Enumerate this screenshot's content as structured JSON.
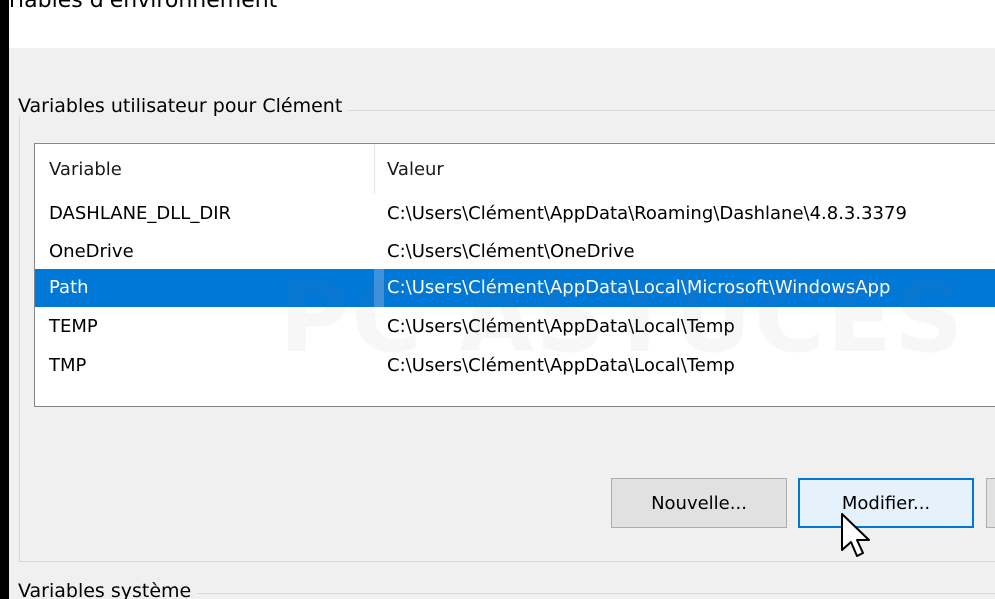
{
  "window": {
    "title": "riables d'environnement"
  },
  "user_group": {
    "label": "Variables utilisateur pour Clément",
    "columns": {
      "variable": "Variable",
      "valeur": "Valeur"
    },
    "rows": [
      {
        "name": "DASHLANE_DLL_DIR",
        "value": "C:\\Users\\Clément\\AppData\\Roaming\\Dashlane\\4.8.3.3379"
      },
      {
        "name": "OneDrive",
        "value": "C:\\Users\\Clément\\OneDrive"
      },
      {
        "name": "Path",
        "value": "C:\\Users\\Clément\\AppData\\Local\\Microsoft\\WindowsApp"
      },
      {
        "name": "TEMP",
        "value": "C:\\Users\\Clément\\AppData\\Local\\Temp"
      },
      {
        "name": "TMP",
        "value": "C:\\Users\\Clément\\AppData\\Local\\Temp"
      }
    ],
    "selected_row": "Path"
  },
  "buttons": {
    "new_label": "Nouvelle...",
    "edit_label": "Modifier..."
  },
  "system_group": {
    "label": "Variables système"
  },
  "watermark": {
    "text": "PC ASTUCES"
  },
  "colors": {
    "selection": "#0078d7",
    "panel": "#f0f0f0"
  },
  "icons": {
    "cursor": "arrow-cursor-icon"
  }
}
